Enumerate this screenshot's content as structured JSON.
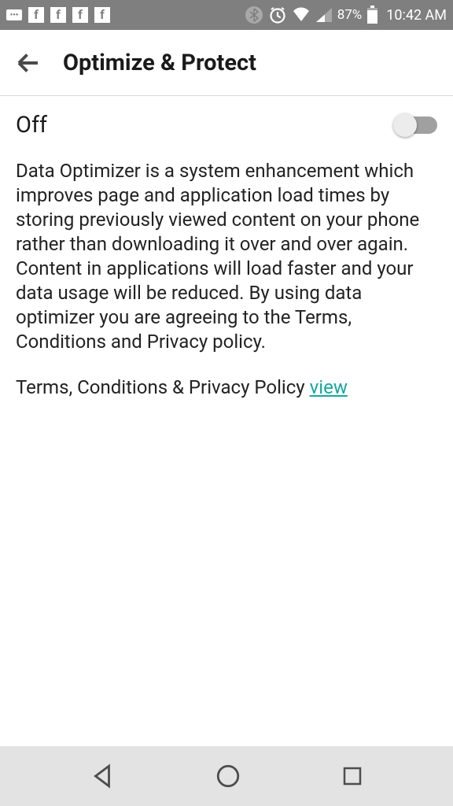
{
  "status_bar": {
    "time": "10:42 AM",
    "battery_pct": "87%"
  },
  "app_bar": {
    "title": "Optimize & Protect"
  },
  "toggle": {
    "state_label": "Off"
  },
  "description": "Data Optimizer is a system enhancement which improves page and application load times by storing previously viewed content on your phone rather than downloading it over and over again. Content in applications will load faster and your data usage will be reduced. By using data optimizer you are agreeing to the Terms, Conditions and Privacy policy.",
  "terms": {
    "label": "Terms, Conditions & Privacy Policy",
    "link_text": "view"
  }
}
